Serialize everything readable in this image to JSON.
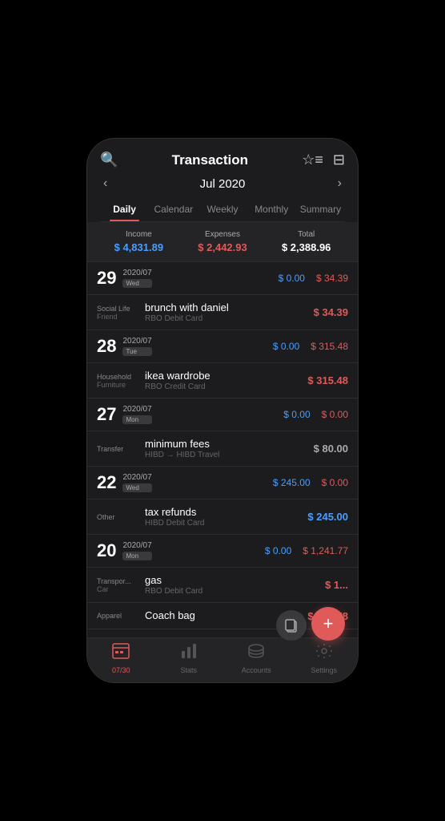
{
  "header": {
    "title": "Transaction",
    "month": "Jul 2020"
  },
  "tabs": [
    {
      "label": "Daily",
      "active": true
    },
    {
      "label": "Calendar",
      "active": false
    },
    {
      "label": "Weekly",
      "active": false
    },
    {
      "label": "Monthly",
      "active": false
    },
    {
      "label": "Summary",
      "active": false
    }
  ],
  "summary": {
    "income_label": "Income",
    "income_value": "$ 4,831.89",
    "expense_label": "Expenses",
    "expense_value": "$ 2,442.93",
    "total_label": "Total",
    "total_value": "$ 2,388.96"
  },
  "days": [
    {
      "number": "29",
      "date": "2020/07",
      "weekday": "Wed",
      "income": "$ 0.00",
      "expense": "$ 34.39",
      "transactions": [
        {
          "cat_main": "Social Life",
          "cat_sub": "Friend",
          "name": "brunch with daniel",
          "account": "RBO Debit Card",
          "amount": "$ 34.39",
          "type": "expense"
        }
      ]
    },
    {
      "number": "28",
      "date": "2020/07",
      "weekday": "Tue",
      "income": "$ 0.00",
      "expense": "$ 315.48",
      "transactions": [
        {
          "cat_main": "Household",
          "cat_sub": "Furniture",
          "name": "ikea wardrobe",
          "account": "RBO Credit Card",
          "amount": "$ 315.48",
          "type": "expense"
        }
      ]
    },
    {
      "number": "27",
      "date": "2020/07",
      "weekday": "Mon",
      "income": "$ 0.00",
      "expense": "$ 0.00",
      "transactions": [
        {
          "cat_main": "Transfer",
          "cat_sub": "",
          "name": "minimum fees",
          "account": "HIBD → HIBD Travel",
          "amount": "$ 80.00",
          "type": "transfer"
        }
      ]
    },
    {
      "number": "22",
      "date": "2020/07",
      "weekday": "Wed",
      "income": "$ 245.00",
      "expense": "$ 0.00",
      "transactions": [
        {
          "cat_main": "Other",
          "cat_sub": "",
          "name": "tax refunds",
          "account": "HIBD Debit Card",
          "amount": "$ 245.00",
          "type": "income"
        }
      ]
    },
    {
      "number": "20",
      "date": "2020/07",
      "weekday": "Mon",
      "income": "$ 0.00",
      "expense": "$ 1,241.77",
      "transactions": [
        {
          "cat_main": "Transpor...",
          "cat_sub": "Car",
          "name": "gas",
          "account": "RBO Debit Card",
          "amount": "$ 1...",
          "type": "expense"
        },
        {
          "cat_main": "Apparel",
          "cat_sub": "",
          "name": "Coach bag",
          "account": "",
          "amount": "$ 800.78",
          "type": "expense"
        }
      ]
    }
  ],
  "bottom_nav": [
    {
      "label": "07/30",
      "icon": "📋",
      "active": true
    },
    {
      "label": "Stats",
      "icon": "📊",
      "active": false
    },
    {
      "label": "Accounts",
      "icon": "🪙",
      "active": false
    },
    {
      "label": "Settings",
      "icon": "⚙️",
      "active": false
    }
  ],
  "fab_label": "+",
  "copy_icon": "⧉"
}
